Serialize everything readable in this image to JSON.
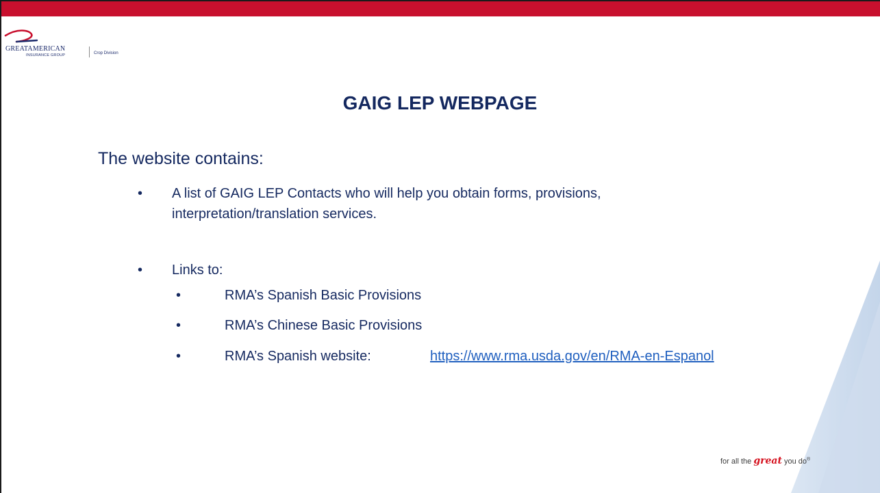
{
  "brand": {
    "logo_text": "GREATAMERICAN",
    "logo_subtext": "INSURANCE GROUP",
    "division": "Crop Division",
    "accent_color": "#c8102e",
    "text_color": "#14285f",
    "link_color": "#1f5fbf"
  },
  "slide": {
    "title": "GAIG LEP WEBPAGE",
    "intro": "The website contains:",
    "bullets": [
      {
        "text_line1": "A list of GAIG LEP Contacts who will help you obtain forms, provisions,",
        "text_line2": "interpretation/translation services."
      },
      {
        "text": "Links to:"
      }
    ],
    "sub_bullets": [
      {
        "text": "RMA’s Spanish Basic Provisions"
      },
      {
        "text": "RMA’s Chinese Basic Provisions"
      },
      {
        "text": "RMA’s Spanish website:",
        "link": "https://www.rma.usda.gov/en/RMA-en-Espanol"
      }
    ],
    "bullet_glyph": "•"
  },
  "footer": {
    "tagline_before": "for all the",
    "tagline_script": "great",
    "tagline_after": "you do",
    "tagline_mark": "®"
  }
}
